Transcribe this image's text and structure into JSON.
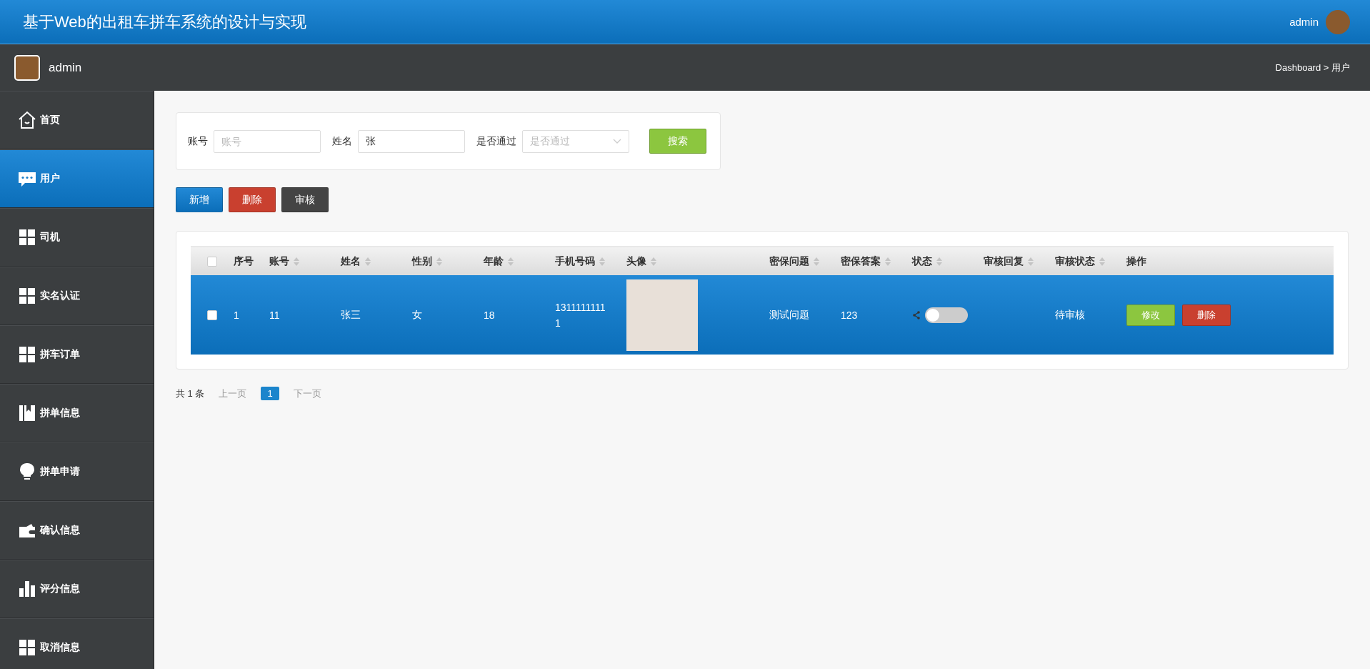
{
  "header": {
    "title": "基于Web的出租车拼车系统的设计与实现",
    "user": "admin"
  },
  "subbar": {
    "user": "admin",
    "breadcrumb": "Dashboard > 用户"
  },
  "sidebar": {
    "items": [
      {
        "label": "首页",
        "kind": "home",
        "selected": false
      },
      {
        "label": "用户",
        "kind": "chat",
        "selected": true
      },
      {
        "label": "司机",
        "kind": "grid",
        "selected": false
      },
      {
        "label": "实名认证",
        "kind": "grid",
        "selected": false
      },
      {
        "label": "拼车订单",
        "kind": "grid",
        "selected": false
      },
      {
        "label": "拼单信息",
        "kind": "book",
        "selected": false
      },
      {
        "label": "拼单申请",
        "kind": "bulb",
        "selected": false
      },
      {
        "label": "确认信息",
        "kind": "wallet",
        "selected": false
      },
      {
        "label": "评分信息",
        "kind": "bars",
        "selected": false
      },
      {
        "label": "取消信息",
        "kind": "grid",
        "selected": false
      }
    ]
  },
  "search": {
    "fields": [
      {
        "label": "账号",
        "kind": "input",
        "placeholder": "账号"
      },
      {
        "label": "姓名",
        "kind": "input",
        "value": "张"
      },
      {
        "label": "是否通过",
        "kind": "select",
        "placeholder": "是否通过"
      }
    ],
    "button": "搜索"
  },
  "actions": [
    {
      "label": "新增",
      "kind": "primary"
    },
    {
      "label": "删除",
      "kind": "danger"
    },
    {
      "label": "审核",
      "kind": "dark"
    }
  ],
  "table": {
    "all_checked": false,
    "columns": [
      {
        "label": "序号",
        "sortable": false
      },
      {
        "label": "账号",
        "sortable": true
      },
      {
        "label": "姓名",
        "sortable": true
      },
      {
        "label": "性别",
        "sortable": true
      },
      {
        "label": "年龄",
        "sortable": true
      },
      {
        "label": "手机号码",
        "sortable": true
      },
      {
        "label": "头像",
        "sortable": true
      },
      {
        "label": "密保问题",
        "sortable": true
      },
      {
        "label": "密保答案",
        "sortable": true
      },
      {
        "label": "状态",
        "sortable": true
      },
      {
        "label": "审核回复",
        "sortable": true
      },
      {
        "label": "审核状态",
        "sortable": true
      },
      {
        "label": "操作",
        "sortable": false
      }
    ],
    "rows": [
      {
        "selected": true,
        "checked": false,
        "cells": [
          "1",
          "11",
          "张三",
          "女",
          "18",
          "13111111111"
        ],
        "question": "测试问题",
        "answer": "123",
        "status_on": false,
        "review": "待审核",
        "buttons": [
          {
            "label": "修改",
            "kind": "success"
          },
          {
            "label": "删除",
            "kind": "danger"
          }
        ]
      }
    ]
  },
  "pagination": {
    "total": "共 1 条",
    "prev": "上一页",
    "pages": [
      {
        "label": "1",
        "selected": true
      }
    ],
    "next": "下一页"
  }
}
